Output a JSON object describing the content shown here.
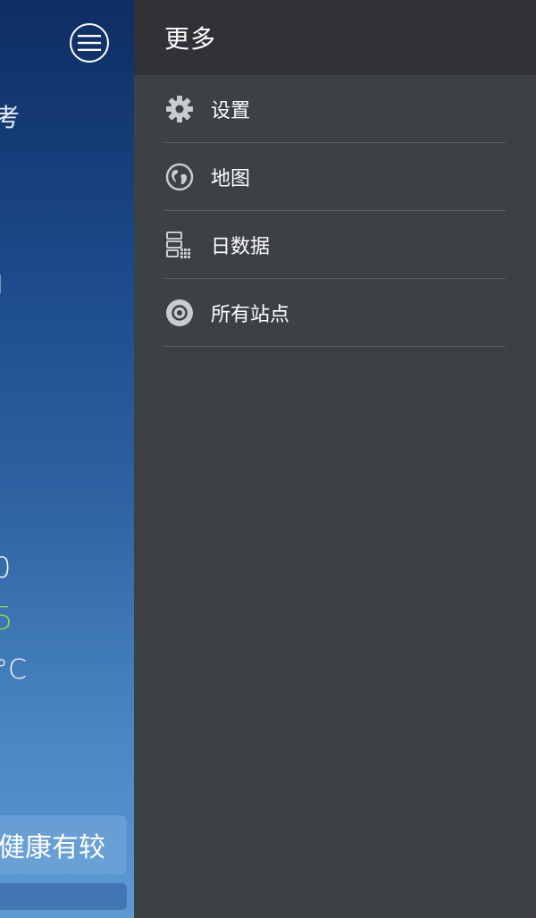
{
  "background_app": {
    "fragment_1": "考",
    "fragment_2": "l",
    "fragment_3": "0",
    "fragment_4": "5",
    "fragment_5": "°C",
    "banner_text": "健康有较"
  },
  "drawer": {
    "title": "更多",
    "items": [
      {
        "label": "设置",
        "icon": "gear-icon"
      },
      {
        "label": "地图",
        "icon": "globe-icon"
      },
      {
        "label": "日数据",
        "icon": "daily-data-icon"
      },
      {
        "label": "所有站点",
        "icon": "target-icon"
      }
    ]
  },
  "colors": {
    "drawer_bg": "#3d4044",
    "header_bg": "#303236",
    "divider": "#5b5e62",
    "icon": "#c9cbcd",
    "green_value": "#8cd14a"
  }
}
